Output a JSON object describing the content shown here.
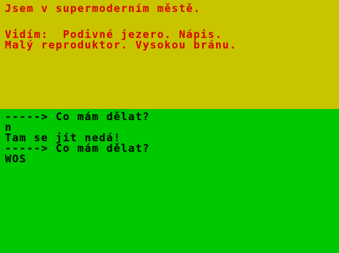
{
  "location": {
    "text": "Jsem v supermoderním městě."
  },
  "description": {
    "line1": "Vidím:  Podivné jezero. Nápis.",
    "line2": "Malý reproduktor. Vysokou bránu."
  },
  "console": {
    "prompt1": "-----> Co mám dělat?",
    "input1": "n",
    "response1": "Tam se jít nedá!",
    "prompt2": "-----> Co mám dělat?",
    "input2": "WOS"
  },
  "colors": {
    "top_background": "#c8c400",
    "top_text": "#d80000",
    "bottom_background": "#00c800",
    "bottom_text": "#000000"
  }
}
